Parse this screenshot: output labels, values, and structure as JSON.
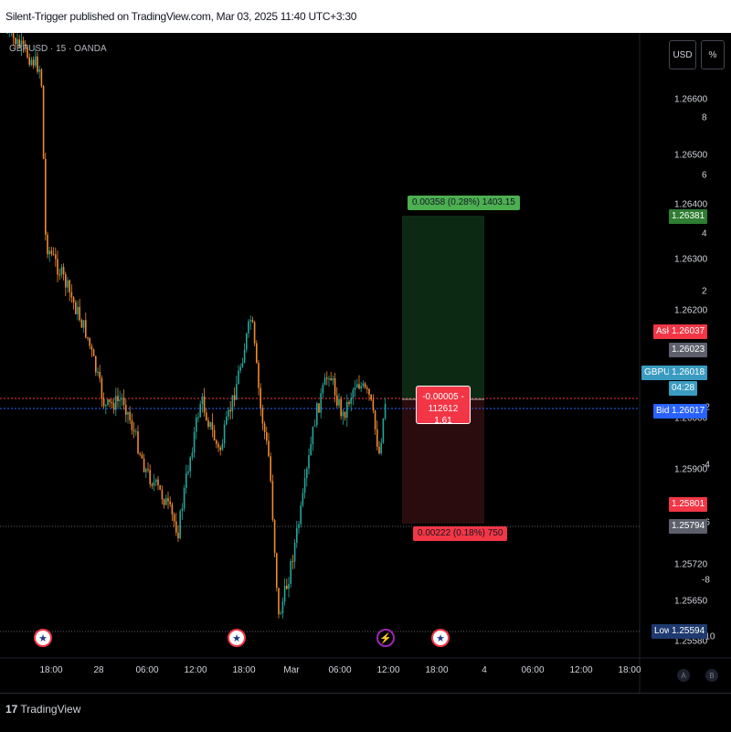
{
  "header": {
    "published_text": "Silent-Trigger published on TradingView.com, Mar 03, 2025 11:40 UTC+3:30"
  },
  "chart": {
    "symbol_label": "GBPUSD · 15 · OANDA",
    "currency_button": "USD",
    "percent_button": "%",
    "price_ticks": [
      "1.26600",
      "1.26500",
      "1.26400",
      "1.26300",
      "1.26200",
      "1.26000",
      "1.25900",
      "1.25720",
      "1.25650",
      "1.25580"
    ],
    "percent_ticks": [
      "8",
      "6",
      "4",
      "2",
      "0",
      "-2",
      "-4",
      "-6",
      "-8",
      "-10"
    ],
    "time_ticks": [
      "18:00",
      "28",
      "06:00",
      "12:00",
      "18:00",
      "Mar",
      "06:00",
      "12:00",
      "18:00",
      "4",
      "06:00",
      "12:00",
      "18:00"
    ],
    "scale_buttons": [
      "A",
      "B"
    ],
    "price_tags": {
      "target": "1.26381",
      "ask_label": "Ask",
      "ask": "1.26037",
      "last": "1.26023",
      "symbol": "GBPUSD",
      "close": "1.26018",
      "countdown": "04:28",
      "bid_label": "Bid",
      "bid": "1.26017",
      "stop": "1.25801",
      "stop_current": "1.25794",
      "low_label": "Low",
      "low": "1.25594"
    },
    "position": {
      "target_text": "0.00358 (0.28%) 1403.15",
      "entry_line1": "-0.00005 - 112612",
      "entry_line2": "1.61",
      "stop_text": "0.00222 (0.18%) 750"
    },
    "colors": {
      "up": "#26a69a",
      "down": "#ef8a2f",
      "profit_zone": "#0c2a13",
      "loss_zone": "#2b0c0e",
      "target_tag": "#2e7d32",
      "stop_tag": "#f23645",
      "ask_tag": "#f23645",
      "bid_tag": "#2962ff",
      "symbol_tag": "#3a9bc1",
      "last_tag": "#5d606b",
      "low_tag": "#1e3a6e"
    },
    "events": [
      "us-flag-icon",
      "us-flag-icon",
      "lightning-icon",
      "us-flag-icon"
    ]
  },
  "footer": {
    "brand": "TradingView"
  }
}
